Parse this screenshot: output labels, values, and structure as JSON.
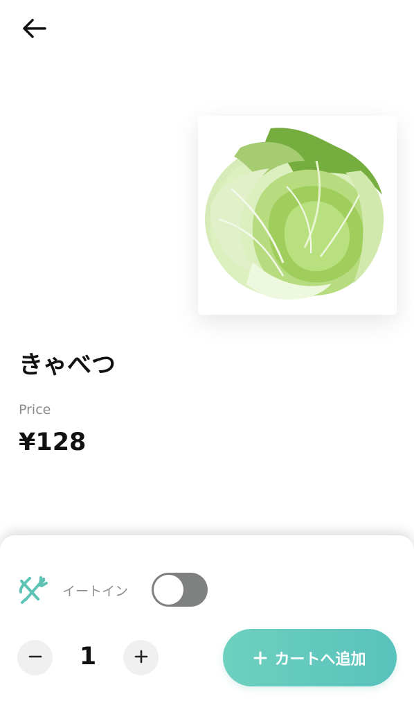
{
  "header": {
    "back_icon": "arrow-left-icon"
  },
  "product": {
    "name": "きゃべつ",
    "image_subject": "cabbage",
    "price_label": "Price",
    "price": "¥128"
  },
  "order_panel": {
    "eat_in_icon": "fork-knife-icon",
    "eat_in_label": "イートイン",
    "eat_in_enabled": false,
    "quantity": "1",
    "minus_icon": "minus-icon",
    "plus_icon": "plus-icon",
    "add_to_cart_label": "カートへ追加"
  },
  "colors": {
    "accent": "#5fc8be",
    "toggle_off": "#7f8080",
    "text_primary": "#111111",
    "text_secondary": "#8b8b8b"
  }
}
